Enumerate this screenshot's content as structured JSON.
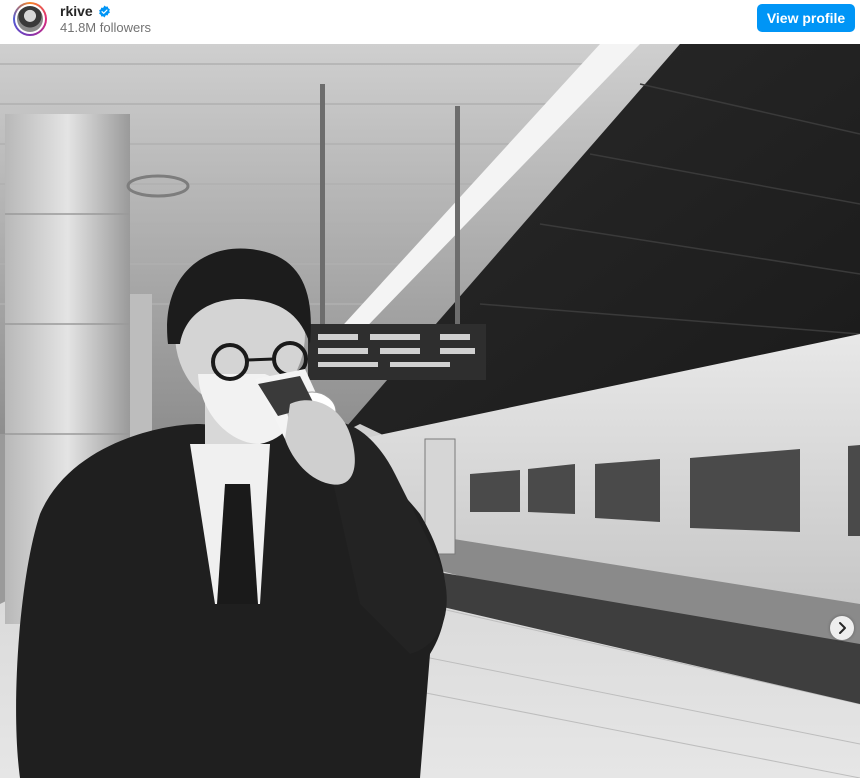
{
  "post": {
    "username": "rkive",
    "verified": true,
    "followers": "41.8M followers",
    "view_profile_label": "View profile",
    "brand_color": "#0095f6"
  },
  "photo": {
    "icons": [
      "verified-badge-icon",
      "chevron-right-icon"
    ]
  }
}
